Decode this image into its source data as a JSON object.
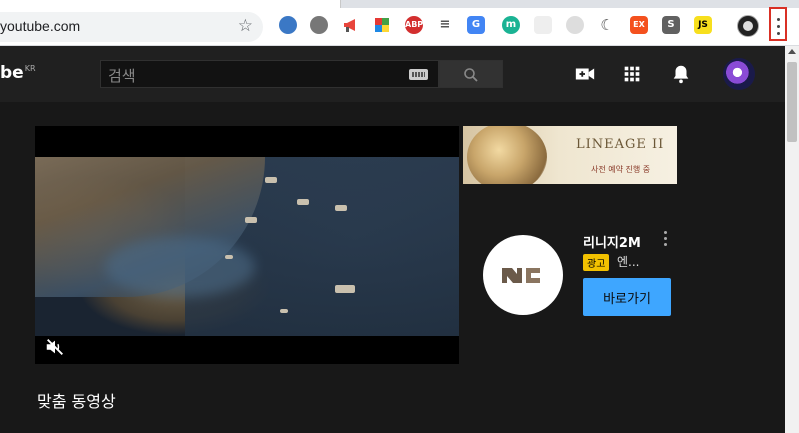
{
  "browser": {
    "url": "youtube.com",
    "extensions": [
      "globe-extension-icon",
      "gear-extension-icon",
      "megaphone-extension-icon",
      "puzzle-extension-icon",
      "adblock-plus-icon",
      "lines-extension-icon",
      "google-translate-icon",
      "m-extension-icon",
      "grid-extension-icon",
      "clock-extension-icon",
      "moon-extension-icon",
      "ex-extension-icon",
      "s-extension-icon",
      "js-extension-icon"
    ],
    "ext_labels": {
      "abp": "ABP",
      "m": "m",
      "ex": "EX",
      "s": "S",
      "js": "JS"
    }
  },
  "header": {
    "logo_text": "be",
    "logo_region": "KR",
    "search_placeholder": "검색"
  },
  "ad": {
    "banner_title": "LINEAGE II",
    "banner_subtitle": "사전 예약 진행 중",
    "advertiser_name": "리니지2M",
    "badge": "광고",
    "description": "엔...",
    "cta_label": "바로가기"
  },
  "main": {
    "section_title": "맞춤 동영상"
  },
  "colors": {
    "accent": "#3ea6ff",
    "badge": "#f2c100",
    "background": "#181818",
    "header": "#202020"
  }
}
